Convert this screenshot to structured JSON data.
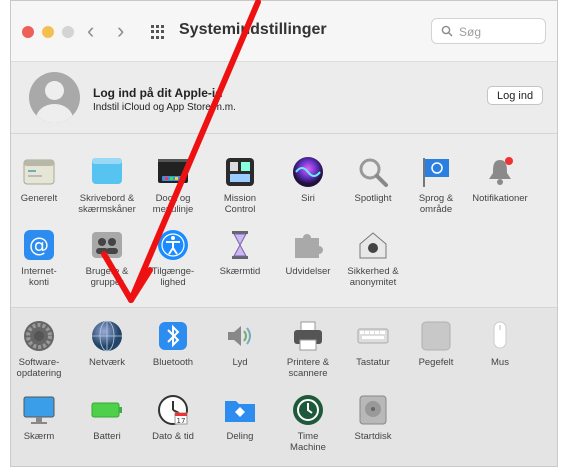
{
  "window": {
    "title": "Systemindstillinger"
  },
  "titlebar": {
    "back_icon": "‹",
    "forward_icon": "›"
  },
  "search": {
    "placeholder": "Søg",
    "value": ""
  },
  "account": {
    "title": "Log ind på dit Apple-id",
    "subtitle": "Indstil iCloud og App Store m.m.",
    "login_button": "Log ind"
  },
  "section1": [
    {
      "key": "general",
      "label": "Generelt",
      "icon": "general-icon"
    },
    {
      "key": "desktop",
      "label": "Skrivebord &\nskærmskåner",
      "icon": "desktop-icon"
    },
    {
      "key": "dock",
      "label": "Dock og\nmenulinje",
      "icon": "dock-icon"
    },
    {
      "key": "mission",
      "label": "Mission\nControl",
      "icon": "mission-control-icon"
    },
    {
      "key": "siri",
      "label": "Siri",
      "icon": "siri-icon"
    },
    {
      "key": "spotlight",
      "label": "Spotlight",
      "icon": "spotlight-icon"
    },
    {
      "key": "language",
      "label": "Sprog &\nområde",
      "icon": "language-flag-icon"
    },
    {
      "key": "notifications",
      "label": "Notifikationer",
      "icon": "bell-icon"
    },
    {
      "key": "internet",
      "label": "Internet-\nkonti",
      "icon": "at-icon"
    },
    {
      "key": "users",
      "label": "Brugere &\ngrupper",
      "icon": "users-icon"
    },
    {
      "key": "accessibility",
      "label": "Tilgænge-\nlighed",
      "icon": "accessibility-icon"
    },
    {
      "key": "screentime",
      "label": "Skærmtid",
      "icon": "hourglass-icon"
    },
    {
      "key": "extensions",
      "label": "Udvidelser",
      "icon": "puzzle-icon"
    },
    {
      "key": "security",
      "label": "Sikkerhed &\nanonymitet",
      "icon": "house-lock-icon"
    }
  ],
  "section2": [
    {
      "key": "update",
      "label": "Software-\nopdatering",
      "icon": "gear-icon"
    },
    {
      "key": "network",
      "label": "Netværk",
      "icon": "globe-icon"
    },
    {
      "key": "bluetooth",
      "label": "Bluetooth",
      "icon": "bluetooth-icon"
    },
    {
      "key": "sound",
      "label": "Lyd",
      "icon": "speaker-icon"
    },
    {
      "key": "printers",
      "label": "Printere &\nscannere",
      "icon": "printer-icon"
    },
    {
      "key": "keyboard",
      "label": "Tastatur",
      "icon": "keyboard-icon"
    },
    {
      "key": "trackpad",
      "label": "Pegefelt",
      "icon": "trackpad-icon"
    },
    {
      "key": "mouse",
      "label": "Mus",
      "icon": "mouse-icon"
    },
    {
      "key": "displays",
      "label": "Skærm",
      "icon": "display-icon"
    },
    {
      "key": "battery",
      "label": "Batteri",
      "icon": "battery-icon"
    },
    {
      "key": "datetime",
      "label": "Dato & tid",
      "icon": "clock-icon"
    },
    {
      "key": "sharing",
      "label": "Deling",
      "icon": "sharing-folder-icon"
    },
    {
      "key": "timemachine",
      "label": "Time\nMachine",
      "icon": "time-machine-icon"
    },
    {
      "key": "startup",
      "label": "Startdisk",
      "icon": "disk-icon"
    }
  ],
  "annotation": {
    "color": "#ee1111",
    "icon": "red-arrow-annotation"
  }
}
